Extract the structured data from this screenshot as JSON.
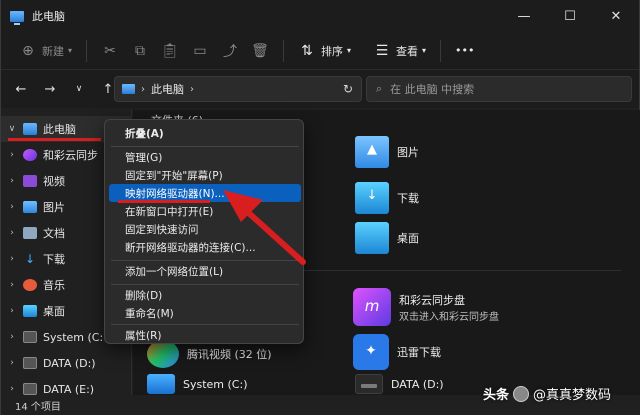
{
  "window": {
    "title": "此电脑",
    "controls": [
      "—",
      "☐",
      "✕"
    ]
  },
  "toolbar": {
    "new_label": "新建",
    "sort_label": "排序",
    "view_label": "查看",
    "more_label": "•••"
  },
  "nav": {
    "breadcrumb": "此电脑",
    "search_placeholder": "在 此电脑 中搜索"
  },
  "sidebar": {
    "items": [
      {
        "label": "此电脑"
      },
      {
        "label": "和彩云同步"
      },
      {
        "label": "视频"
      },
      {
        "label": "图片"
      },
      {
        "label": "文档"
      },
      {
        "label": "下载"
      },
      {
        "label": "音乐"
      },
      {
        "label": "桌面"
      },
      {
        "label": "System (C:"
      },
      {
        "label": "DATA (D:)"
      },
      {
        "label": "DATA (E:)"
      }
    ]
  },
  "content": {
    "group_header": "文件夹 (6)",
    "tiles": {
      "pictures": "图片",
      "downloads": "下载",
      "desktop": "桌面",
      "hecaiyun_name": "和彩云同步盘",
      "hecaiyun_sub": "双击进入和彩云同步盘",
      "tencent_video": "腾讯视频 (32 位)",
      "xunlei": "迅雷下载",
      "system_c": "System (C:)",
      "data_d": "DATA (D:)"
    }
  },
  "context_menu": {
    "items": [
      "折叠(A)",
      "管理(G)",
      "固定到\"开始\"屏幕(P)",
      "映射网络驱动器(N)...",
      "在新窗口中打开(E)",
      "固定到快速访问",
      "断开网络驱动器的连接(C)...",
      "添加一个网络位置(L)",
      "删除(D)",
      "重命名(M)",
      "属性(R)"
    ]
  },
  "status": {
    "count": "14 个项目"
  },
  "watermark": {
    "brand": "头条",
    "handle": "@真真梦数码"
  },
  "colors": {
    "highlight": "#0b5fbd",
    "annotation_red": "#d81e1e"
  }
}
